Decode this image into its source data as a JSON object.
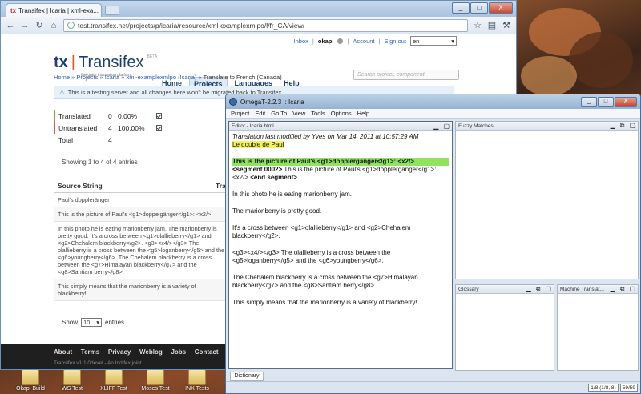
{
  "browser": {
    "tab_title": "Transifex | Icaria | xml-exa...",
    "address": "test.transifex.net/projects/p/icaria/resource/xml-examplexmlpo/l/fr_CA/view/",
    "min_label": "_",
    "max_label": "□",
    "close_label": "X"
  },
  "tx": {
    "userbar": {
      "inbox": "Inbox",
      "user": "okapi",
      "account": "Account",
      "signout": "Sign out",
      "lang": "en"
    },
    "logo": {
      "tx": "tx",
      "name": "Transifex",
      "beta": "BETA",
      "tagline": "the open translation platform"
    },
    "nav": [
      "Home",
      "Projects",
      "Languages",
      "Help"
    ],
    "search_placeholder": "Search project, component",
    "breadcrumb": {
      "home": "Home",
      "projects": "Projects",
      "project": "Icaria",
      "resource": "xml-examplexmlpo (Icaria)",
      "current": "Translate to French (Canada)"
    },
    "notice": "This is a testing server and all changes here won't be migrated back to Transifex.",
    "stats": [
      {
        "label": "Translated",
        "count": "0",
        "percent": "0.00%"
      },
      {
        "label": "Untranslated",
        "count": "4",
        "percent": "100.00%"
      },
      {
        "label": "Total",
        "count": "4",
        "percent": ""
      }
    ],
    "entries_info": "Showing 1 to 4 of 4 entries",
    "table": {
      "col_source": "Source String",
      "col_trans": "Tra",
      "rows": [
        "Paul's doppleränger",
        "This is the picture of Paul's <g1>doppelgänger</g1>: <x2/>",
        "In this photo he is eating marionberry jam. The marionberry is pretty good. It's a cross between <g1>olallieberry</g1> and <g2>Chehalem blackberry</g2>. <g3><x4/></g3> The olallieberry is a cross between the <g5>loganberry</g5> and the <g6>youngberry</g6>. The Chehalem blackberry is a cross between the <g7>Himalayan blackberry</g7> and the <g8>Santiam berry</g8>.",
        "This simply means that the marionberry is a variety of blackberry!"
      ]
    },
    "show_label": "Show",
    "show_value": "10",
    "entries_label": "entries",
    "footer": {
      "links": [
        "About",
        "Terms",
        "Privacy",
        "Weblog",
        "Jobs",
        "Contact"
      ],
      "version": "Transifex v1.1.0devel - An Indifex joint"
    }
  },
  "omegat": {
    "title": "OmegaT-2.2.3 :: Icaria",
    "menu": [
      "Project",
      "Edit",
      "Go To",
      "View",
      "Tools",
      "Options",
      "Help"
    ],
    "editor_title": "Editor - Icaria.html",
    "fuzzy_title": "Fuzzy Matches",
    "glossary_title": "Glossary",
    "mt_title": "Machine Translat...",
    "dictionary_tab": "Dictionary",
    "editor": {
      "modified": "Translation last modified by Yves on Mar 14, 2011 at 10:57:29 AM",
      "translation": "Le double de Paul",
      "active_source": "This is the picture of Paul's <g1>dopplergänger</g1>: <x2/>",
      "segment_marker": "<segment 0002>",
      "segment_text": "This is the picture of Paul's <g1>dopplergänger</g1>: <x2/>",
      "segment_end": "<end segment>",
      "paragraphs": [
        "In this photo he is eating marionberry jam.",
        "The marionberry is pretty good.",
        "It's a cross between <g1>olallieberry</g1> and <g2>Chehalem blackberry</g2>.",
        "<g3><x4/></g3> The olallieberry is a cross between the <g5>loganberry</g5> and the <g6>youngberry</g6>.",
        "The Chehalem blackberry is a cross between the <g7>Himalayan blackberry</g7> and the <g8>Santiam berry</g8>.",
        "This simply means that the marionberry is a variety of blackberry!"
      ]
    },
    "status": {
      "progress": "1/8 (1/8, 8)",
      "segments": "59/59"
    }
  },
  "desktop": {
    "icons": [
      "Okapi Build",
      "WS Test",
      "XLIFF Test",
      "Moses Test",
      "INX Tests"
    ]
  },
  "colors": {
    "tx_navy": "#1c3f6e",
    "tx_orange": "#d25c2a",
    "translated_green": "#6fb43f",
    "untranslated_red": "#d9534f",
    "highlight_yellow": "#f5f25a",
    "active_green": "#8fe35f"
  }
}
